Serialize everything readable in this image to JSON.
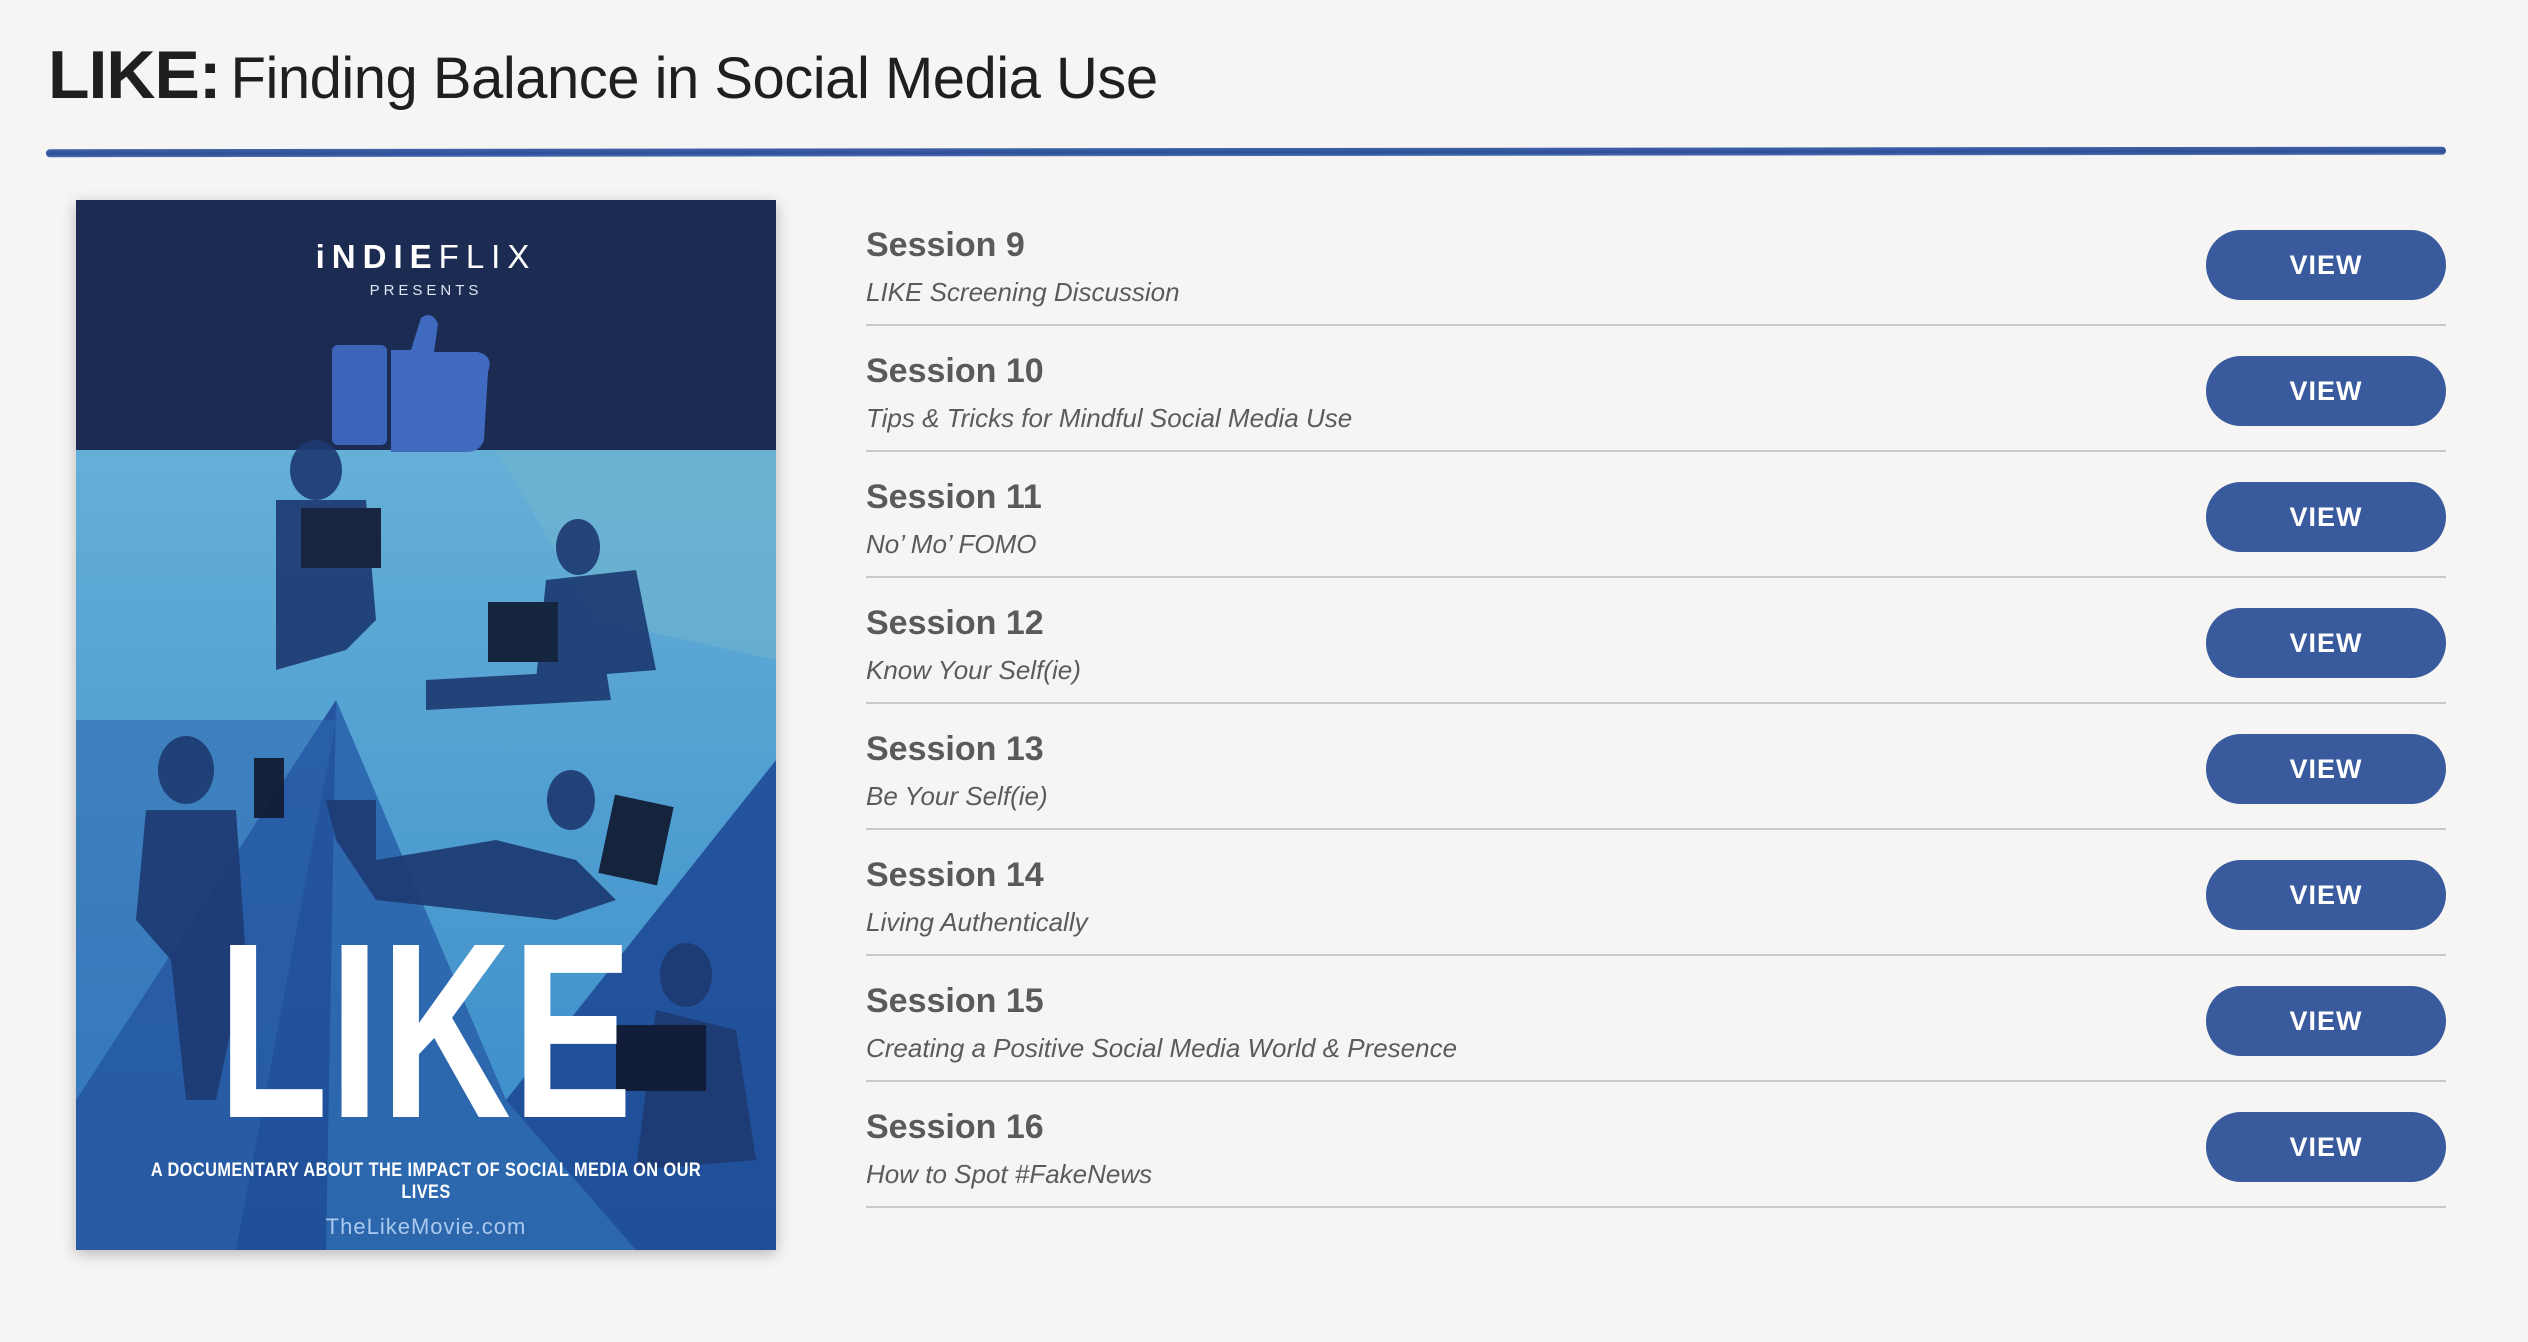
{
  "header": {
    "title_strong": "LIKE:",
    "title_rest": "Finding Balance in Social Media Use"
  },
  "poster": {
    "brand_bold": "iNDIE",
    "brand_light": "FLIX",
    "presents": "PRESENTS",
    "title": "LIKE",
    "tagline": "A DOCUMENTARY ABOUT THE IMPACT OF SOCIAL MEDIA ON OUR LIVES",
    "url": "TheLikeMovie.com",
    "colors": {
      "dark": "#1c2b52",
      "mid": "#2f67b4",
      "light": "#5ec2ea"
    }
  },
  "sessions": [
    {
      "title": "Session 9",
      "subtitle": "LIKE Screening Discussion",
      "button": "VIEW"
    },
    {
      "title": "Session 10",
      "subtitle": "Tips & Tricks for Mindful Social Media Use",
      "button": "VIEW"
    },
    {
      "title": "Session 11",
      "subtitle": "No’ Mo’ FOMO",
      "button": "VIEW"
    },
    {
      "title": "Session 12",
      "subtitle": "Know Your Self(ie)",
      "button": "VIEW"
    },
    {
      "title": "Session 13",
      "subtitle": "Be Your Self(ie)",
      "button": "VIEW"
    },
    {
      "title": "Session 14",
      "subtitle": "Living Authentically",
      "button": "VIEW"
    },
    {
      "title": "Session 15",
      "subtitle": "Creating a Positive Social Media World & Presence",
      "button": "VIEW"
    },
    {
      "title": "Session 16",
      "subtitle": "How to Spot #FakeNews",
      "button": "VIEW"
    }
  ],
  "colors": {
    "accent": "#395a9d",
    "rule": "#3a5ca3",
    "background": "#f6f5f3"
  }
}
